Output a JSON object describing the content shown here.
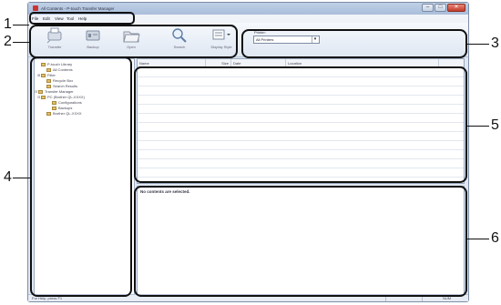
{
  "window": {
    "title": "All Contents - P-touch Transfer Manager",
    "buttons": {
      "minimize": "–",
      "maximize": "□",
      "close": "✕"
    }
  },
  "menu": [
    "File",
    "Edit",
    "View",
    "Tool",
    "Help"
  ],
  "toolbar": {
    "transfer": "Transfer",
    "backup": "Backup",
    "open": "Open",
    "search": "Search",
    "display_style": "Display Style",
    "printer_caption": "Printer:",
    "printer_value": "All Printers"
  },
  "tree": [
    {
      "label": "P-touch Library",
      "expander": ""
    },
    {
      "label": "All Contents",
      "expander": ""
    },
    {
      "label": "Filter",
      "expander": "⊞"
    },
    {
      "label": "Recycle Box",
      "expander": ""
    },
    {
      "label": "Search Results",
      "expander": ""
    },
    {
      "label": "Transfer Manager",
      "expander": "⊟"
    },
    {
      "label": "PC (Brother QL-XXXX)",
      "expander": "⊟"
    },
    {
      "label": "Configurations",
      "expander": ""
    },
    {
      "label": "Backups",
      "expander": ""
    },
    {
      "label": "Brother QL-XXXX",
      "expander": ""
    }
  ],
  "list": {
    "columns": [
      "Name",
      "Size",
      "Date",
      "Location"
    ]
  },
  "preview": {
    "message": "No contents are selected."
  },
  "status": {
    "text": "For Help, press F1",
    "indicator": "NUM"
  },
  "callouts": [
    "1",
    "2",
    "3",
    "4",
    "5",
    "6"
  ]
}
